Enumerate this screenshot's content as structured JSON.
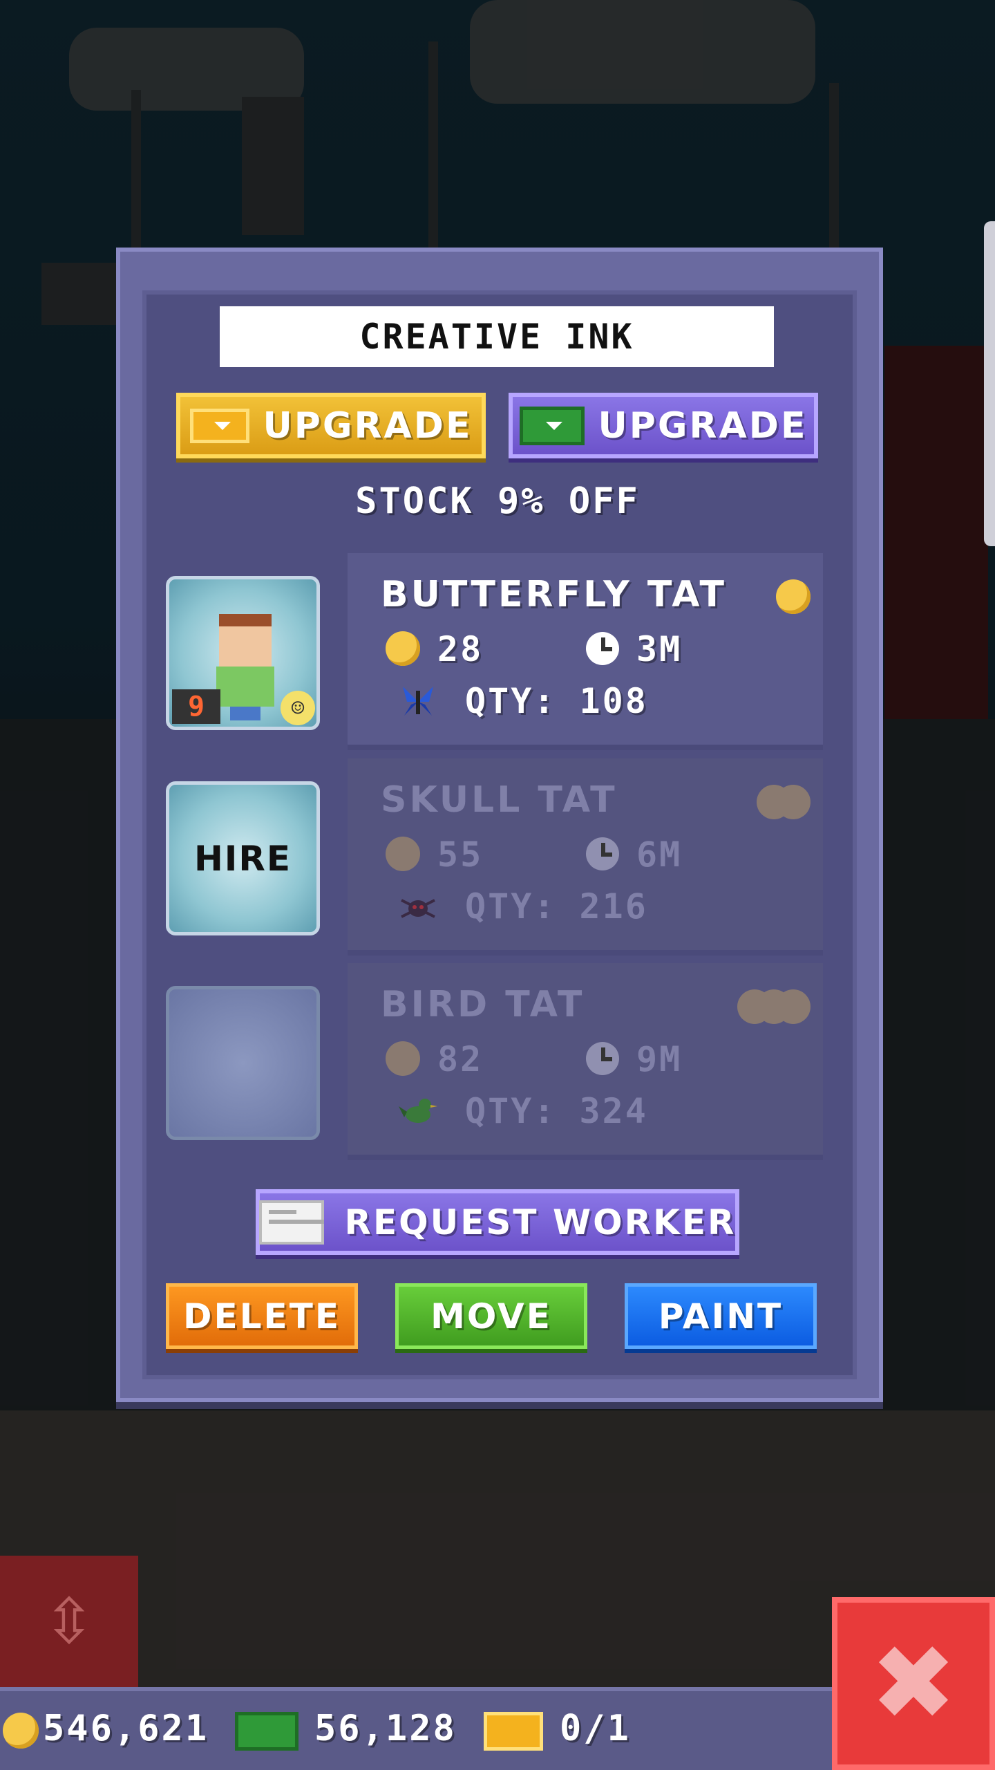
{
  "dialog": {
    "title": "CREATIVE INK",
    "upgrade_gold_label": "UPGRADE",
    "upgrade_bux_label": "UPGRADE",
    "discount_text": "STOCK 9% OFF",
    "hire_label": "HIRE",
    "request_label": "REQUEST WORKER",
    "delete_label": "DELETE",
    "move_label": "MOVE",
    "paint_label": "PAINT"
  },
  "worker": {
    "level": "9"
  },
  "products": [
    {
      "name": "BUTTERFLY TAT",
      "cost": "28",
      "time": "3M",
      "qty": "QTY: 108",
      "icon": "butterfly-icon",
      "coins": 1,
      "active": true
    },
    {
      "name": "SKULL TAT",
      "cost": "55",
      "time": "6M",
      "qty": "QTY: 216",
      "icon": "spider-icon",
      "coins": 2,
      "active": false
    },
    {
      "name": "BIRD TAT",
      "cost": "82",
      "time": "9M",
      "qty": "QTY: 324",
      "icon": "bird-icon",
      "coins": 3,
      "active": false
    }
  ],
  "bottom_bar": {
    "coins": "546,621",
    "bux": "56,128",
    "tickets": "0/1"
  },
  "colors": {
    "gold": "#f3c43a",
    "purple": "#7a62d8",
    "delete": "#f08010",
    "move": "#52b82c",
    "paint": "#1a72f0",
    "close": "#e83a3a"
  }
}
